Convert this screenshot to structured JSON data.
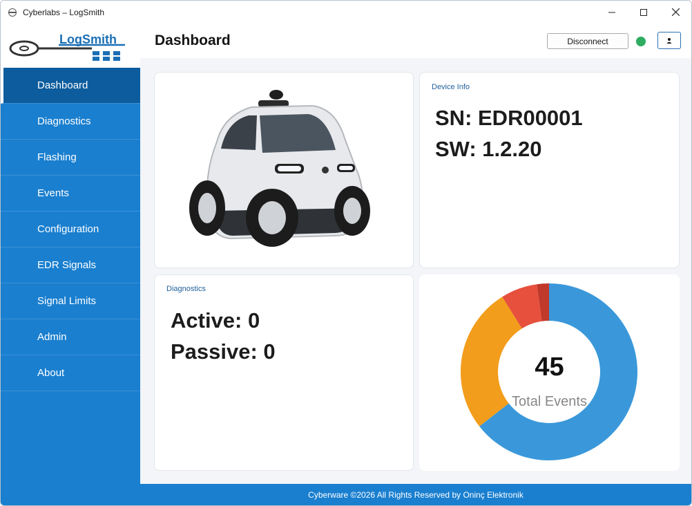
{
  "window": {
    "title": "Cyberlabs – LogSmith"
  },
  "logo": {
    "text": "LogSmith"
  },
  "sidebar": {
    "items": [
      {
        "label": "Dashboard"
      },
      {
        "label": "Diagnostics"
      },
      {
        "label": "Flashing"
      },
      {
        "label": "Events"
      },
      {
        "label": "Configuration"
      },
      {
        "label": "EDR Signals"
      },
      {
        "label": "Signal Limits"
      },
      {
        "label": "Admin"
      },
      {
        "label": "About"
      }
    ],
    "active_index": 0
  },
  "header": {
    "title": "Dashboard",
    "disconnect_label": "Disconnect",
    "status": "connected",
    "status_color": "#2ead60"
  },
  "device_info": {
    "label": "Device Info",
    "sn": "SN: EDR00001",
    "sw": "SW: 1.2.20"
  },
  "diagnostics": {
    "label": "Diagnostics",
    "active": "Active: 0",
    "passive": "Passive: 0"
  },
  "events_chart": {
    "total": "45",
    "total_label": "Total Events"
  },
  "chart_data": {
    "type": "pie",
    "style": "donut",
    "values": [
      29,
      12,
      3,
      1
    ],
    "colors": [
      "#3a98da",
      "#f29d1b",
      "#e6503d",
      "#c0392b"
    ]
  },
  "footer": {
    "text": "Cyberware ©2026 All Rights Reserved by Oninç Elektronik"
  }
}
